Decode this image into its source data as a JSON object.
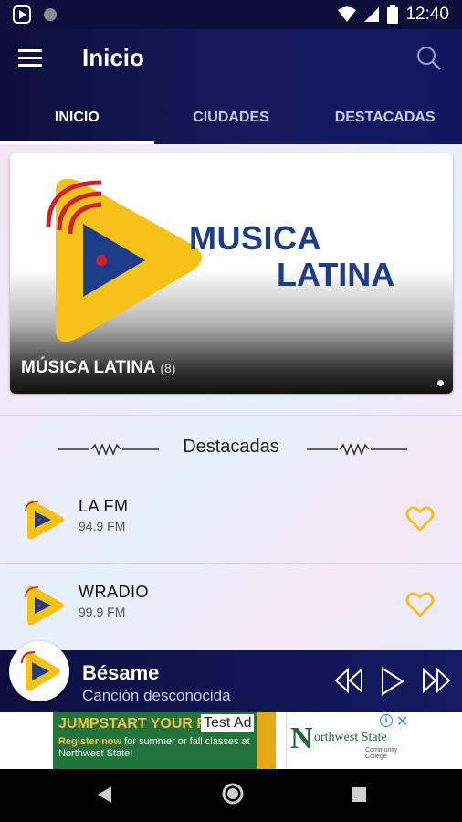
{
  "status_bar": {
    "time": "12:40"
  },
  "app_bar": {
    "title": "Inicio"
  },
  "tabs": [
    {
      "label": "INICIO",
      "active": true
    },
    {
      "label": "CIUDADES",
      "active": false
    },
    {
      "label": "DESTACADAS",
      "active": false
    }
  ],
  "banner": {
    "logo_line1": "MUSICA",
    "logo_line2": "LATINA",
    "caption": "MÚSICA LATINA",
    "count": "(8)"
  },
  "featured": {
    "title": "Destacadas",
    "stations": [
      {
        "name": "LA FM",
        "frequency": "94.9 FM"
      },
      {
        "name": "WRADIO",
        "frequency": "99.9 FM"
      }
    ]
  },
  "player": {
    "title": "Bésame",
    "subtitle": "Canción desconocida"
  },
  "ad": {
    "headline": "JUMPSTART YOUR F",
    "line_register": "Register now",
    "line_rest": " for summer or fall classes at Northwest State!",
    "test_label": "Test Ad",
    "brand_n": "N",
    "brand_name": "orthwest State",
    "brand_sub": "Community College"
  },
  "colors": {
    "appbar": "#121660",
    "accent_yellow": "#f6c21a",
    "logo_blue": "#1c3d8a",
    "logo_red": "#d0202a"
  }
}
